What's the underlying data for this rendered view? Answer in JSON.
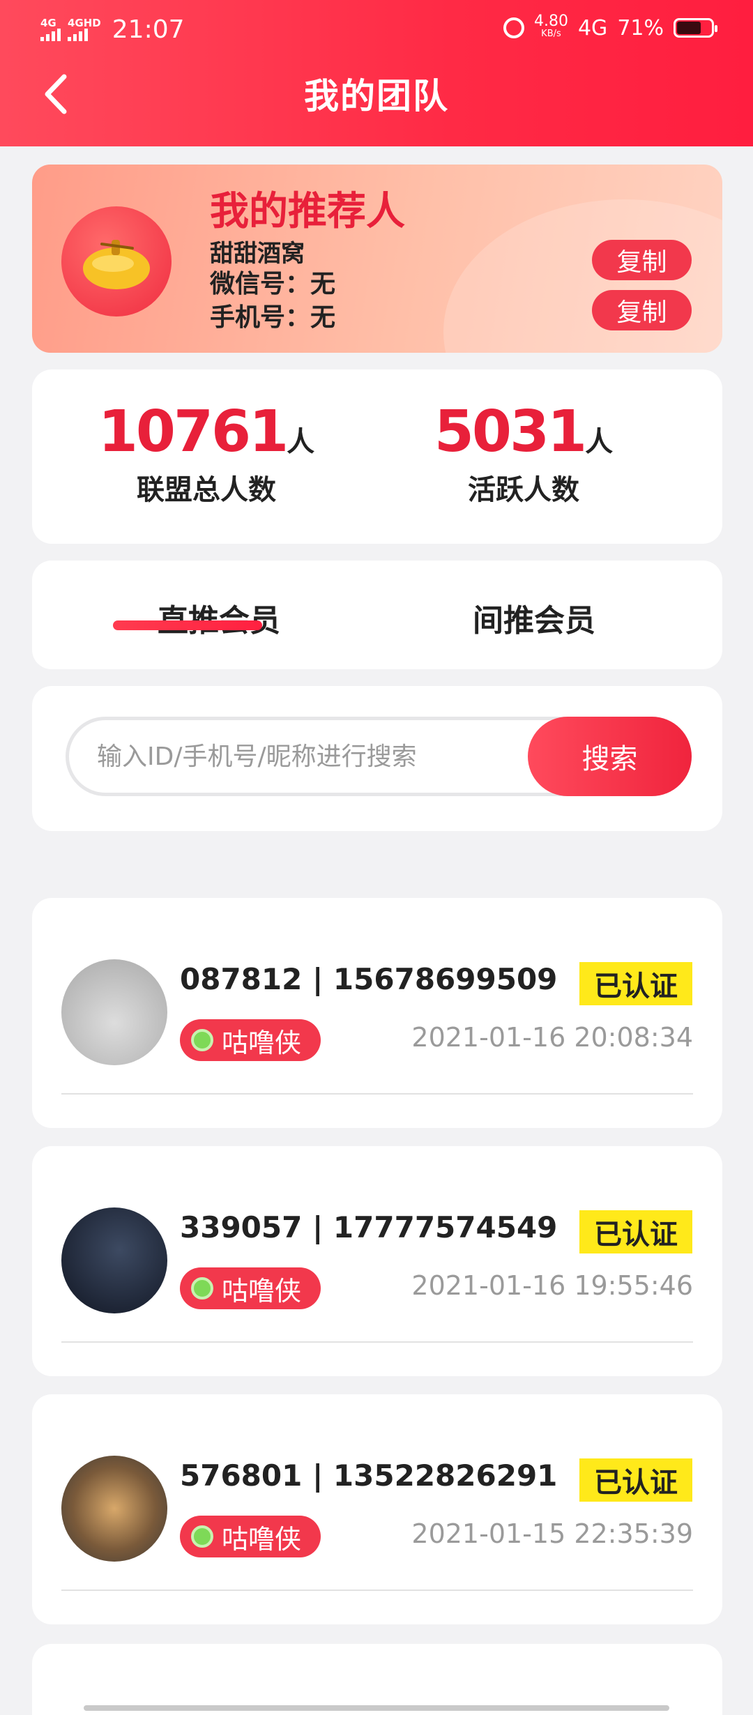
{
  "status_bar": {
    "net1": "4G",
    "net2": "4GHD",
    "time": "21:07",
    "speed_value": "4.80",
    "speed_unit": "KB/s",
    "net3": "4G",
    "battery": "71%",
    "battery_level": 0.71
  },
  "header": {
    "title": "我的团队",
    "back_icon": "chevron-left-icon"
  },
  "referrer": {
    "title": "我的推荐人",
    "name": "甜甜酒窝",
    "wechat": "微信号：无",
    "phone": "手机号：无",
    "copy_label_1": "复制",
    "copy_label_2": "复制"
  },
  "stats": {
    "total_value": "10761",
    "total_unit": "人",
    "total_label": "联盟总人数",
    "active_value": "5031",
    "active_unit": "人",
    "active_label": "活跃人数"
  },
  "tabs": [
    {
      "label": "直推会员",
      "active": true
    },
    {
      "label": "间推会员",
      "active": false
    }
  ],
  "search": {
    "placeholder": "输入ID/手机号/昵称进行搜索",
    "value": "",
    "button": "搜索"
  },
  "members": [
    {
      "id_phone": "087812 | 15678699509",
      "level": "咕噜侠",
      "status": "已认证",
      "time": "2021-01-16 20:08:34"
    },
    {
      "id_phone": "339057 | 17777574549",
      "level": "咕噜侠",
      "status": "已认证",
      "time": "2021-01-16 19:55:46"
    },
    {
      "id_phone": "576801 | 13522826291",
      "level": "咕噜侠",
      "status": "已认证",
      "time": "2021-01-15 22:35:39"
    }
  ],
  "colors": {
    "accent": "#ff2a45",
    "verified": "#ffe91a",
    "badge": "#f2384c"
  }
}
